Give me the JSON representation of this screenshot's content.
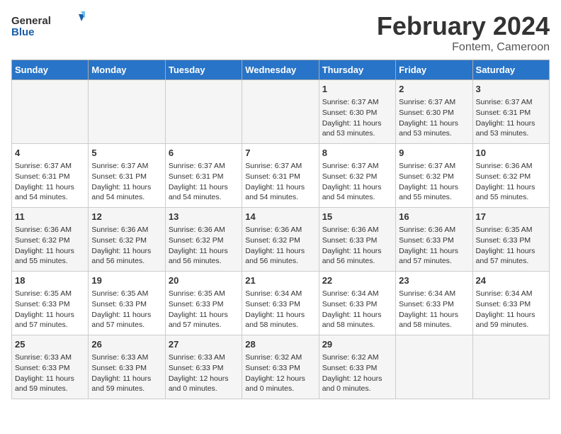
{
  "logo": {
    "text_general": "General",
    "text_blue": "Blue"
  },
  "header": {
    "month_year": "February 2024",
    "location": "Fontem, Cameroon"
  },
  "weekdays": [
    "Sunday",
    "Monday",
    "Tuesday",
    "Wednesday",
    "Thursday",
    "Friday",
    "Saturday"
  ],
  "weeks": [
    [
      {
        "day": "",
        "content": ""
      },
      {
        "day": "",
        "content": ""
      },
      {
        "day": "",
        "content": ""
      },
      {
        "day": "",
        "content": ""
      },
      {
        "day": "1",
        "content": "Sunrise: 6:37 AM\nSunset: 6:30 PM\nDaylight: 11 hours\nand 53 minutes."
      },
      {
        "day": "2",
        "content": "Sunrise: 6:37 AM\nSunset: 6:30 PM\nDaylight: 11 hours\nand 53 minutes."
      },
      {
        "day": "3",
        "content": "Sunrise: 6:37 AM\nSunset: 6:31 PM\nDaylight: 11 hours\nand 53 minutes."
      }
    ],
    [
      {
        "day": "4",
        "content": "Sunrise: 6:37 AM\nSunset: 6:31 PM\nDaylight: 11 hours\nand 54 minutes."
      },
      {
        "day": "5",
        "content": "Sunrise: 6:37 AM\nSunset: 6:31 PM\nDaylight: 11 hours\nand 54 minutes."
      },
      {
        "day": "6",
        "content": "Sunrise: 6:37 AM\nSunset: 6:31 PM\nDaylight: 11 hours\nand 54 minutes."
      },
      {
        "day": "7",
        "content": "Sunrise: 6:37 AM\nSunset: 6:31 PM\nDaylight: 11 hours\nand 54 minutes."
      },
      {
        "day": "8",
        "content": "Sunrise: 6:37 AM\nSunset: 6:32 PM\nDaylight: 11 hours\nand 54 minutes."
      },
      {
        "day": "9",
        "content": "Sunrise: 6:37 AM\nSunset: 6:32 PM\nDaylight: 11 hours\nand 55 minutes."
      },
      {
        "day": "10",
        "content": "Sunrise: 6:36 AM\nSunset: 6:32 PM\nDaylight: 11 hours\nand 55 minutes."
      }
    ],
    [
      {
        "day": "11",
        "content": "Sunrise: 6:36 AM\nSunset: 6:32 PM\nDaylight: 11 hours\nand 55 minutes."
      },
      {
        "day": "12",
        "content": "Sunrise: 6:36 AM\nSunset: 6:32 PM\nDaylight: 11 hours\nand 56 minutes."
      },
      {
        "day": "13",
        "content": "Sunrise: 6:36 AM\nSunset: 6:32 PM\nDaylight: 11 hours\nand 56 minutes."
      },
      {
        "day": "14",
        "content": "Sunrise: 6:36 AM\nSunset: 6:32 PM\nDaylight: 11 hours\nand 56 minutes."
      },
      {
        "day": "15",
        "content": "Sunrise: 6:36 AM\nSunset: 6:33 PM\nDaylight: 11 hours\nand 56 minutes."
      },
      {
        "day": "16",
        "content": "Sunrise: 6:36 AM\nSunset: 6:33 PM\nDaylight: 11 hours\nand 57 minutes."
      },
      {
        "day": "17",
        "content": "Sunrise: 6:35 AM\nSunset: 6:33 PM\nDaylight: 11 hours\nand 57 minutes."
      }
    ],
    [
      {
        "day": "18",
        "content": "Sunrise: 6:35 AM\nSunset: 6:33 PM\nDaylight: 11 hours\nand 57 minutes."
      },
      {
        "day": "19",
        "content": "Sunrise: 6:35 AM\nSunset: 6:33 PM\nDaylight: 11 hours\nand 57 minutes."
      },
      {
        "day": "20",
        "content": "Sunrise: 6:35 AM\nSunset: 6:33 PM\nDaylight: 11 hours\nand 57 minutes."
      },
      {
        "day": "21",
        "content": "Sunrise: 6:34 AM\nSunset: 6:33 PM\nDaylight: 11 hours\nand 58 minutes."
      },
      {
        "day": "22",
        "content": "Sunrise: 6:34 AM\nSunset: 6:33 PM\nDaylight: 11 hours\nand 58 minutes."
      },
      {
        "day": "23",
        "content": "Sunrise: 6:34 AM\nSunset: 6:33 PM\nDaylight: 11 hours\nand 58 minutes."
      },
      {
        "day": "24",
        "content": "Sunrise: 6:34 AM\nSunset: 6:33 PM\nDaylight: 11 hours\nand 59 minutes."
      }
    ],
    [
      {
        "day": "25",
        "content": "Sunrise: 6:33 AM\nSunset: 6:33 PM\nDaylight: 11 hours\nand 59 minutes."
      },
      {
        "day": "26",
        "content": "Sunrise: 6:33 AM\nSunset: 6:33 PM\nDaylight: 11 hours\nand 59 minutes."
      },
      {
        "day": "27",
        "content": "Sunrise: 6:33 AM\nSunset: 6:33 PM\nDaylight: 12 hours\nand 0 minutes."
      },
      {
        "day": "28",
        "content": "Sunrise: 6:32 AM\nSunset: 6:33 PM\nDaylight: 12 hours\nand 0 minutes."
      },
      {
        "day": "29",
        "content": "Sunrise: 6:32 AM\nSunset: 6:33 PM\nDaylight: 12 hours\nand 0 minutes."
      },
      {
        "day": "",
        "content": ""
      },
      {
        "day": "",
        "content": ""
      }
    ]
  ]
}
